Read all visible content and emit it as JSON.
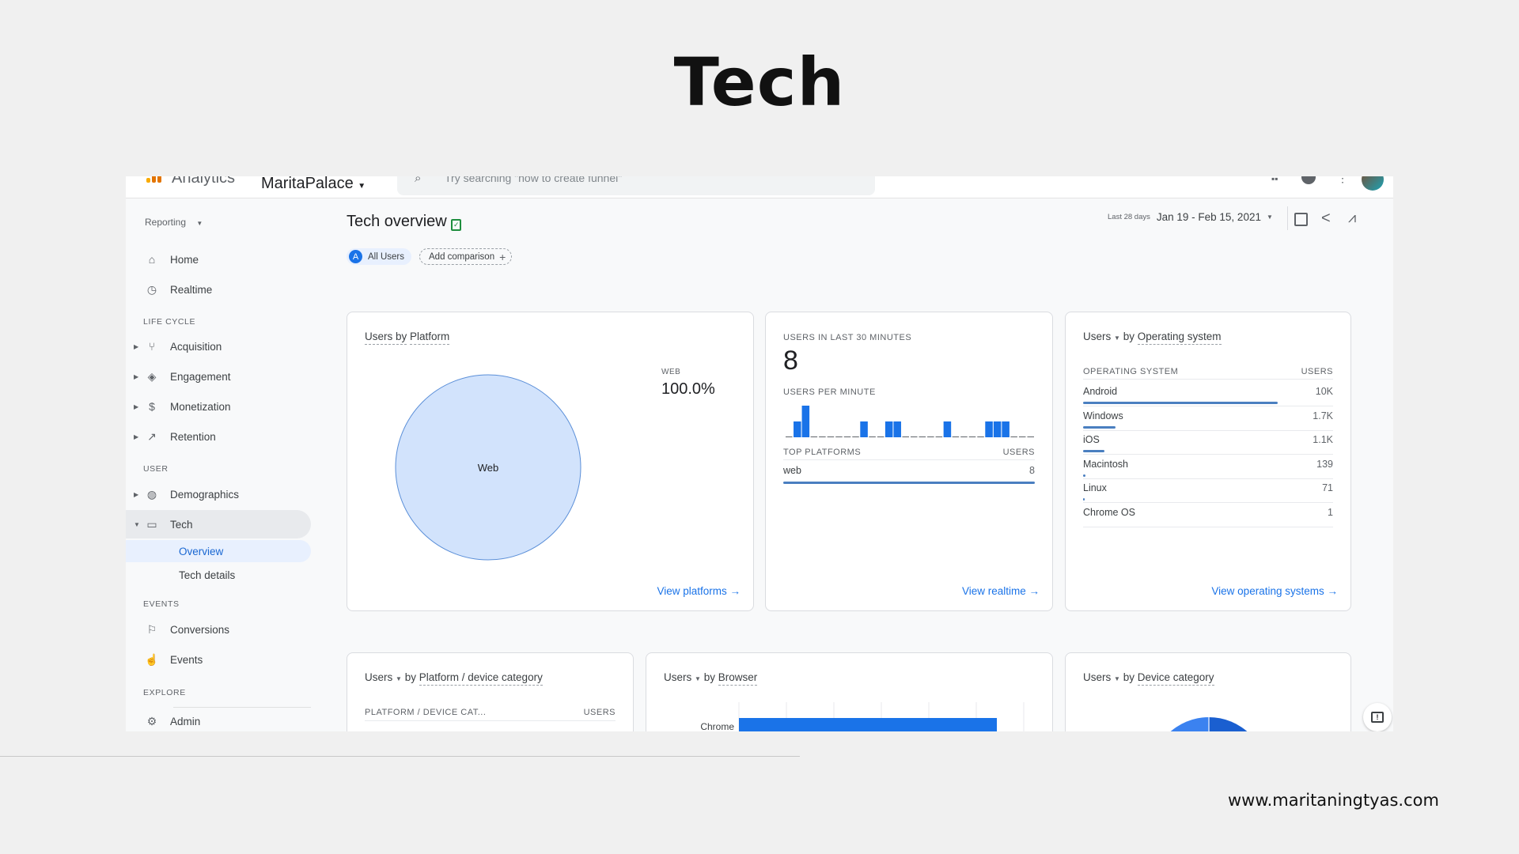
{
  "slide": {
    "title": "Tech",
    "footer_url": "www.maritaningtyas.com"
  },
  "topbar": {
    "product": "Analytics",
    "property": "MaritaPalace",
    "search_placeholder": "Try searching \"how to create funnel\""
  },
  "sidebar": {
    "reporting": "Reporting",
    "items": [
      {
        "label": "Home",
        "icon": "home-icon"
      },
      {
        "label": "Realtime",
        "icon": "clock-icon"
      }
    ],
    "sections": [
      {
        "title": "LIFE CYCLE",
        "items": [
          "Acquisition",
          "Engagement",
          "Monetization",
          "Retention"
        ]
      },
      {
        "title": "USER",
        "items": [
          "Demographics",
          "Tech"
        ],
        "sub_items": [
          "Overview",
          "Tech details"
        ]
      },
      {
        "title": "EVENTS",
        "items": [
          "Conversions",
          "Events"
        ]
      },
      {
        "title": "EXPLORE",
        "items": [
          "Admin"
        ]
      }
    ],
    "active": "Overview"
  },
  "header": {
    "title": "Tech overview",
    "date_range_label": "Last 28 days",
    "date_range": "Jan 19 - Feb 15, 2021",
    "comparison_badge": "A",
    "comparison": "All Users",
    "add_comparison": "Add comparison"
  },
  "cards": {
    "platform": {
      "metric": "Users by",
      "dimension": "Platform",
      "slice_label": "Web",
      "legend_label": "WEB",
      "legend_value": "100.0%",
      "link": "View platforms",
      "chart_data": {
        "type": "pie",
        "categories": [
          "Web"
        ],
        "values": [
          100.0
        ]
      }
    },
    "realtime": {
      "title": "USERS IN LAST 30 MINUTES",
      "value": "8",
      "per_minute_label": "USERS PER MINUTE",
      "chart_data": {
        "type": "bar",
        "values": [
          0,
          1,
          2,
          0,
          0,
          0,
          0,
          0,
          0,
          1,
          0,
          0,
          1,
          1,
          0,
          0,
          0,
          0,
          0,
          1,
          0,
          0,
          0,
          0,
          1,
          1,
          1,
          0,
          0,
          0
        ]
      },
      "table_header": [
        "TOP PLATFORMS",
        "USERS"
      ],
      "rows": [
        {
          "name": "web",
          "value": "8",
          "fraction": 1.0
        }
      ],
      "link": "View realtime"
    },
    "os": {
      "metric": "Users",
      "dimension": "by Operating system",
      "dimension_name": "Operating system",
      "table_header": [
        "OPERATING SYSTEM",
        "USERS"
      ],
      "rows": [
        {
          "name": "Android",
          "value": "10K",
          "fraction": 0.78
        },
        {
          "name": "Windows",
          "value": "1.7K",
          "fraction": 0.13
        },
        {
          "name": "iOS",
          "value": "1.1K",
          "fraction": 0.085
        },
        {
          "name": "Macintosh",
          "value": "139",
          "fraction": 0.01
        },
        {
          "name": "Linux",
          "value": "71",
          "fraction": 0.005
        },
        {
          "name": "Chrome OS",
          "value": "1",
          "fraction": 0.0
        }
      ],
      "link": "View operating systems"
    },
    "device_cat": {
      "metric": "Users",
      "by": "by",
      "dimension": "Platform / device category",
      "table_header": [
        "PLATFORM / DEVICE CAT...",
        "USERS"
      ]
    },
    "browser": {
      "metric": "Users",
      "by": "by",
      "dimension": "Browser",
      "chart_data": {
        "type": "bar",
        "categories": [
          "Chrome"
        ]
      }
    },
    "device": {
      "metric": "Users",
      "by": "by",
      "dimension": "Device category"
    }
  },
  "colors": {
    "accent": "#1a73e8",
    "pie_light": "#d2e3fc",
    "bar": "#1a73e8"
  }
}
